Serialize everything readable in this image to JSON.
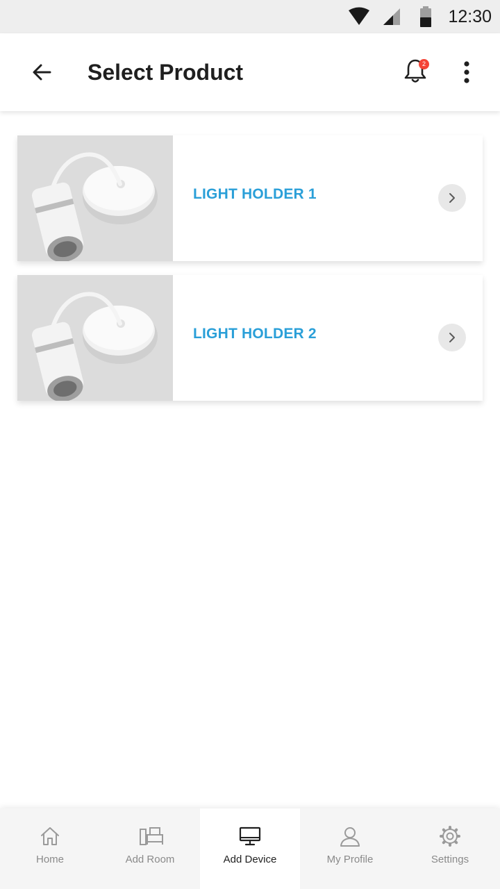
{
  "status_bar": {
    "time": "12:30",
    "icons": [
      "wifi-icon",
      "signal-icon",
      "battery-icon"
    ]
  },
  "app_bar": {
    "title": "Select Product",
    "notification_count": "2",
    "icons": [
      "back-arrow-icon",
      "bell-icon",
      "more-vert-icon"
    ]
  },
  "products": [
    {
      "name": "LIGHT HOLDER 1"
    },
    {
      "name": "LIGHT HOLDER 2"
    }
  ],
  "bottom_nav": {
    "items": [
      {
        "label": "Home",
        "icon": "home-icon",
        "active": false
      },
      {
        "label": "Add Room",
        "icon": "room-icon",
        "active": false
      },
      {
        "label": "Add Device",
        "icon": "monitor-icon",
        "active": true
      },
      {
        "label": "My Profile",
        "icon": "profile-icon",
        "active": false
      },
      {
        "label": "Settings",
        "icon": "gear-icon",
        "active": false
      }
    ]
  },
  "colors": {
    "accent": "#2a9fd8",
    "badge": "#f44336",
    "status_bar_bg": "#eeeeee",
    "nav_bg": "#f5f5f5"
  }
}
